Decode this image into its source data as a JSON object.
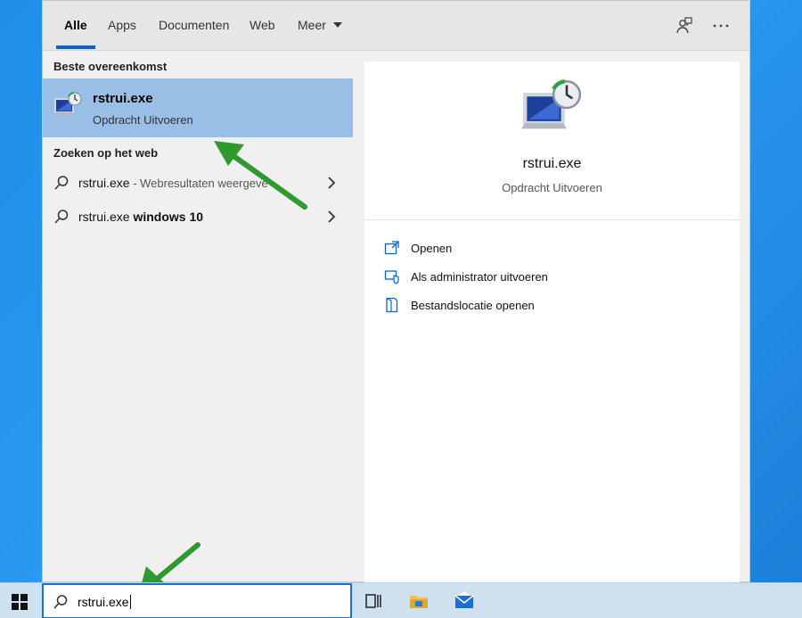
{
  "tabs": [
    {
      "label": "Alle"
    },
    {
      "label": "Apps"
    },
    {
      "label": "Documenten"
    },
    {
      "label": "Web"
    },
    {
      "label": "Meer"
    }
  ],
  "toolbar_icons": [
    "feedback-icon",
    "more-options-icon"
  ],
  "best_match": {
    "header": "Beste overeenkomst",
    "title": "rstrui.exe",
    "subtitle": "Opdracht Uitvoeren",
    "icon": "system-restore-icon"
  },
  "web": {
    "header": "Zoeken op het web",
    "results": [
      {
        "query": "rstrui.exe",
        "suffix": " - Webresultaten weergeve",
        "bold": ""
      },
      {
        "query": "rstrui.exe ",
        "suffix": "",
        "bold": "windows 10"
      }
    ]
  },
  "detail": {
    "title": "rstrui.exe",
    "subtitle": "Opdracht Uitvoeren",
    "actions": [
      {
        "label": "Openen",
        "icon": "open-icon"
      },
      {
        "label": "Als administrator uitvoeren",
        "icon": "run-as-admin-icon"
      },
      {
        "label": "Bestandslocatie openen",
        "icon": "file-location-icon"
      }
    ]
  },
  "search": {
    "value": "rstrui.exe"
  },
  "taskbar_icons": [
    "windows-start-icon",
    "task-view-icon",
    "file-explorer-icon",
    "mail-icon"
  ],
  "colors": {
    "accent": "#0a64c8",
    "selected_row": "#99bfe6",
    "arrow": "#2e9a2e",
    "desktop": "#1f8ee6"
  }
}
